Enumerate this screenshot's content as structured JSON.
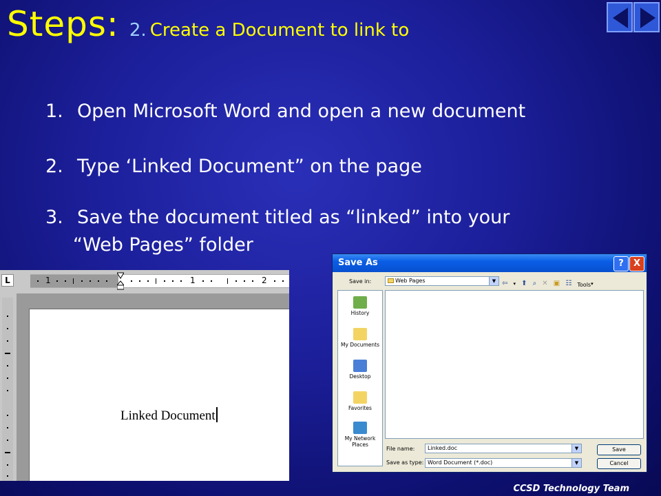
{
  "slide": {
    "title": "Steps:",
    "step_number": "2.",
    "subtitle": "Create a Document to link to",
    "footer": "CCSD Technology Team"
  },
  "nav": {
    "prev_icon": "triangle-left-icon",
    "next_icon": "triangle-right-icon"
  },
  "steps": [
    {
      "num": "1.",
      "text": "Open Microsoft Word and open a new document"
    },
    {
      "num": "2.",
      "text": "Type ‘Linked Document” on the page"
    },
    {
      "num": "3.",
      "text": "Save the document titled as “linked” into your",
      "continuation": "“Web Pages” folder"
    }
  ],
  "word": {
    "tab_stop": "L",
    "ruler_labels": [
      "1",
      "1",
      "2"
    ],
    "document_text": "Linked Document"
  },
  "dialog": {
    "title": "Save As",
    "help": "?",
    "close": "X",
    "save_in_label": "Save in:",
    "save_in_value": "Web Pages",
    "tools_label": "Tools",
    "places": [
      {
        "label": "History",
        "icon": "history-icon",
        "color": "#6fae4a"
      },
      {
        "label": "My Documents",
        "icon": "my-documents-icon",
        "color": "#f3d463"
      },
      {
        "label": "Desktop",
        "icon": "desktop-icon",
        "color": "#4a7fd8"
      },
      {
        "label": "Favorites",
        "icon": "favorites-icon",
        "color": "#f3d463"
      },
      {
        "label": "My Network Places",
        "icon": "network-places-icon",
        "color": "#3a8ad0"
      }
    ],
    "file_name_label": "File name:",
    "file_name_value": "Linked.doc",
    "save_type_label": "Save as type:",
    "save_type_value": "Word Document (*.doc)",
    "save_button": "Save",
    "cancel_button": "Cancel"
  }
}
